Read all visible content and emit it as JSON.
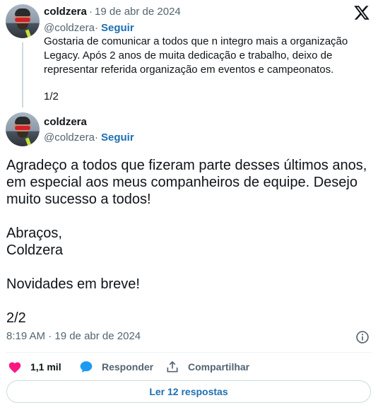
{
  "tweet1": {
    "author_name": "coldzera",
    "separator": "·",
    "date": "19 de abr de 2024",
    "handle": "@coldzera",
    "handle_sep": "·",
    "follow_label": "Seguir",
    "text": "Gostaria de comunicar a todos que n integro mais a organização Legacy. Após 2 anos de muita dedicação e trabalho, deixo de representar referida organização em eventos e campeonatos.",
    "counter": "1/2"
  },
  "tweet2": {
    "author_name": "coldzera",
    "handle": "@coldzera",
    "handle_sep": "·",
    "follow_label": "Seguir",
    "paragraph1": "Agradeço a todos que fizeram parte desses últimos anos, em especial aos meus companheiros de equipe. Desejo muito sucesso a todos!",
    "paragraph2_line1": "Abraços,",
    "paragraph2_line2": "Coldzera",
    "paragraph3": "Novidades em breve!",
    "counter": "2/2",
    "timestamp": "8:19 AM · 19 de abr de 2024"
  },
  "actions": {
    "likes": "1,1 mil",
    "reply_label": "Responder",
    "share_label": "Compartilhar"
  },
  "read_replies_label": "Ler 12 respostas",
  "icons": {
    "logo": "x-logo-icon",
    "like": "heart-icon",
    "reply": "speech-bubble-icon",
    "share": "share-upload-icon",
    "info": "info-icon"
  },
  "colors": {
    "link": "#1d6fb0",
    "like": "#f91880",
    "reply": "#1d9bf0",
    "secondary_text": "#536471"
  }
}
